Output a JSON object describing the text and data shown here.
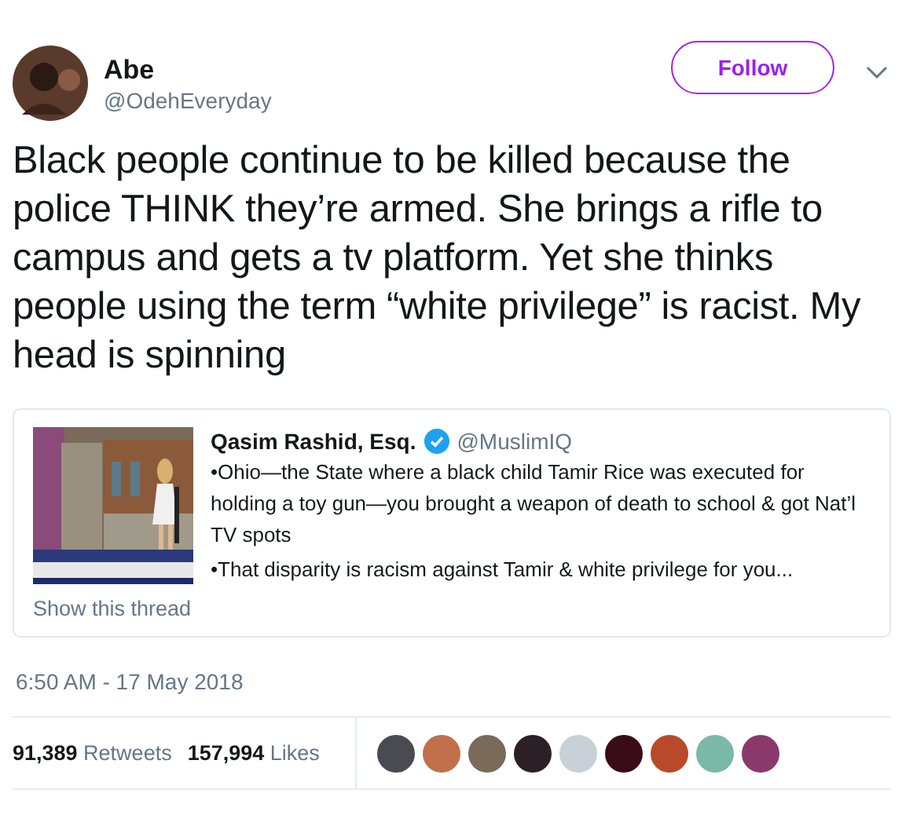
{
  "author": {
    "name": "Abe",
    "handle": "@OdehEveryday"
  },
  "follow_button": {
    "label": "Follow"
  },
  "tweet_text": "Black people continue to be killed because the police THINK they’re armed. She brings a rifle to campus and gets a tv platform. Yet she thinks people using the term “white privilege” is racist. My head is spinning",
  "quoted_tweet": {
    "name": "Qasim Rashid, Esq.",
    "verified": true,
    "handle": "@MuslimIQ",
    "lines": [
      "•Ohio—the State where a black child Tamir Rice was executed for holding a toy gun—you brought a weapon of death to school & got Nat’l TV spots",
      "•That disparity is racism against Tamir & white privilege for you..."
    ],
    "show_thread": "Show this thread"
  },
  "timestamp": "6:50 AM - 17 May 2018",
  "stats": [
    {
      "count": "91,389",
      "label": "Retweets"
    },
    {
      "count": "157,994",
      "label": "Likes"
    }
  ],
  "liker_avatars": [
    {
      "color": "#4a4a52"
    },
    {
      "color": "#c0704a"
    },
    {
      "color": "#7a6a5a"
    },
    {
      "color": "#2a2026"
    },
    {
      "color": "#c8d0d8"
    },
    {
      "color": "#3a0c18"
    },
    {
      "color": "#b84a2a"
    },
    {
      "color": "#7ab8a8"
    },
    {
      "color": "#8a3a6a"
    }
  ]
}
